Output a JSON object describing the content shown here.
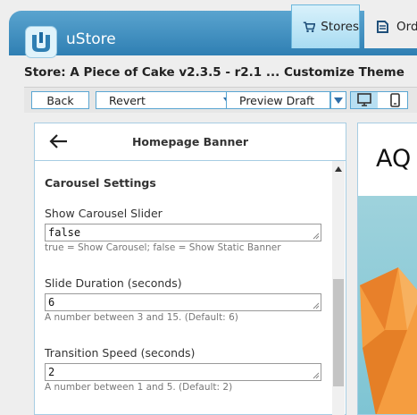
{
  "app": {
    "name": "uStore"
  },
  "nav": {
    "tabs": [
      {
        "label": "Stores",
        "icon": "cart-icon",
        "active": true
      },
      {
        "label": "Orde",
        "icon": "orders-icon",
        "active": false
      }
    ]
  },
  "store_title": "Store: A Piece of Cake v2.3.5 - r2.1 ... Customize Theme",
  "toolbar": {
    "back_label": "Back",
    "revert_label": "Revert",
    "preview_label": "Preview Draft",
    "devices": [
      "desktop-icon",
      "mobile-icon"
    ]
  },
  "panel": {
    "title": "Homepage Banner",
    "section_title": "Carousel Settings",
    "fields": [
      {
        "label": "Show Carousel Slider",
        "value": "false",
        "help": "true = Show Carousel; false = Show Static Banner"
      },
      {
        "label": "Slide Duration (seconds)",
        "value": "6",
        "help": "A number between 3 and 15. (Default: 6)"
      },
      {
        "label": "Transition Speed (seconds)",
        "value": "2",
        "help": "A number between 1 and 5. (Default: 2)"
      }
    ]
  },
  "preview": {
    "brand_text": "AQ"
  },
  "colors": {
    "accent": "#2f7fb3",
    "border": "#5aa6d2",
    "active_tab": "#a8dcf2",
    "preview_bg": "#7ec4d3",
    "origami": "#f59d40"
  }
}
